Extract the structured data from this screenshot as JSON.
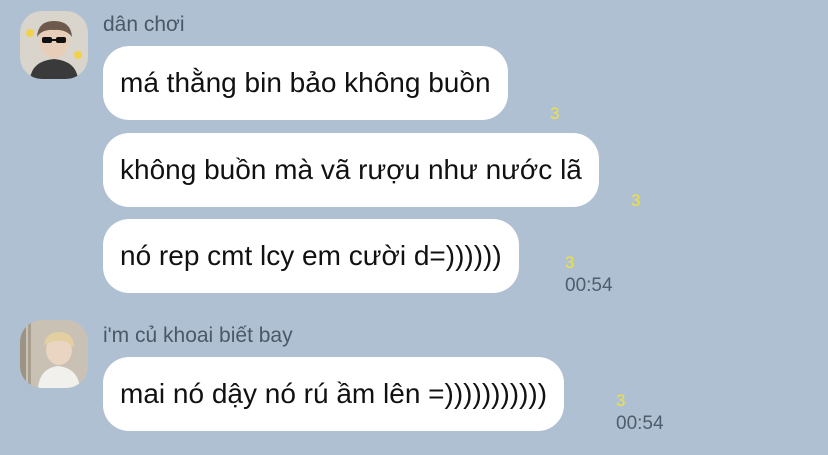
{
  "groups": [
    {
      "sender": "dân chơi",
      "avatar": "avatar-sunglasses-person",
      "messages": [
        {
          "text": "má thằng bin bảo không buồn",
          "unread": "3"
        },
        {
          "text": "không buồn mà vã rượu như nước lã",
          "unread": "3"
        },
        {
          "text": "nó rep cmt lcy em cười d=))))))",
          "unread": "3",
          "time": "00:54"
        }
      ]
    },
    {
      "sender": "i'm củ khoai biết bay",
      "avatar": "avatar-blonde-person",
      "messages": [
        {
          "text": "mai nó dậy nó rú ầm lên =)))))))))))",
          "unread": "3",
          "time": "00:54"
        }
      ]
    }
  ],
  "colors": {
    "background": "#afc0d2",
    "bubble": "#ffffff",
    "unread": "#f1e23b",
    "meta_text": "#4f5d6c"
  }
}
